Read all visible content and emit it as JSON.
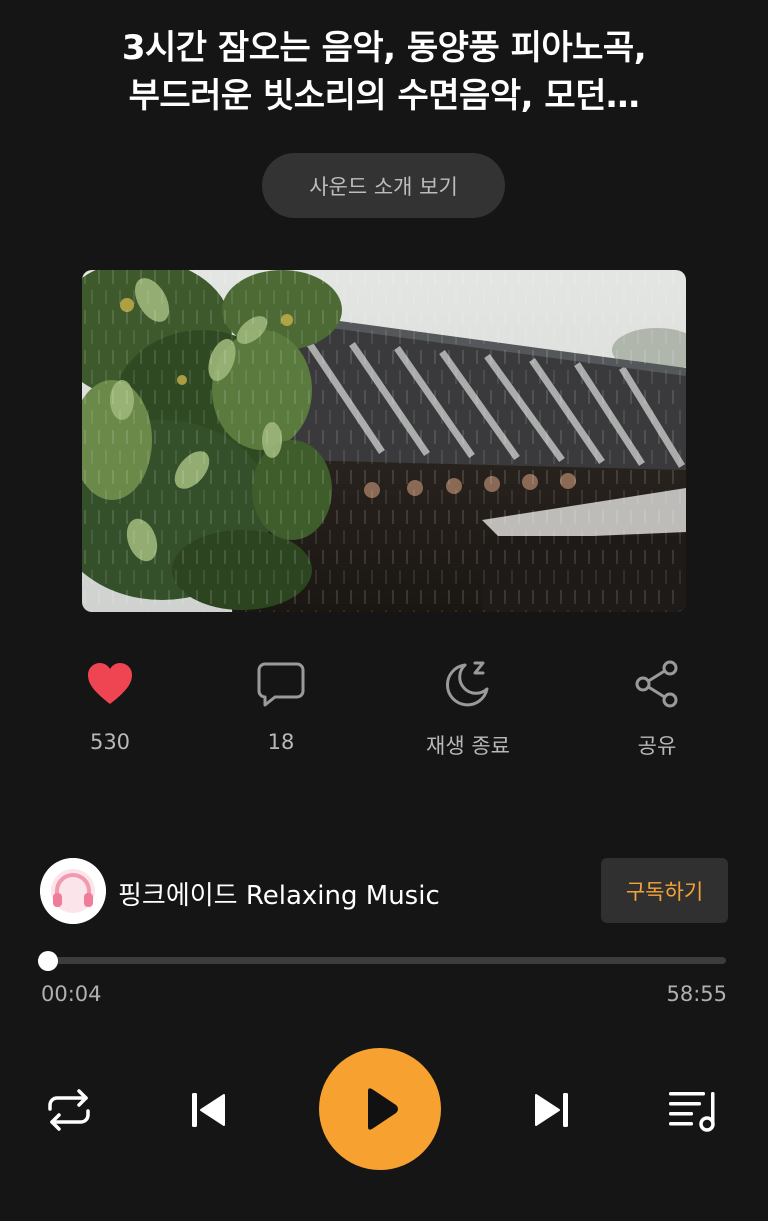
{
  "title": {
    "line1": "3시간 잠오는 음악, 동양풍 피아노곡,",
    "line2": "부드러운 빗소리의 수면음악, 모던…"
  },
  "intro_button": "사운드 소개 보기",
  "artwork": {
    "description_icon": "rain-hanok-artwork"
  },
  "actions": {
    "like": {
      "icon": "heart-icon",
      "label": "530",
      "color": "#ef4452"
    },
    "comment": {
      "icon": "comment-icon",
      "label": "18"
    },
    "sleep_timer": {
      "icon": "moon-z-icon",
      "label": "재생 종료"
    },
    "share": {
      "icon": "share-icon",
      "label": "공유"
    }
  },
  "channel": {
    "name": "핑크에이드 Relaxing Music",
    "subscribe_label": "구독하기",
    "accent": "#f5a338"
  },
  "progress": {
    "elapsed": "00:04",
    "total": "58:55",
    "fraction": 0.001
  },
  "controls": {
    "repeat": "repeat-icon",
    "previous": "skip-previous-icon",
    "play": "play-icon",
    "next": "skip-next-icon",
    "playlist": "playlist-icon",
    "play_color": "#f7a130"
  }
}
